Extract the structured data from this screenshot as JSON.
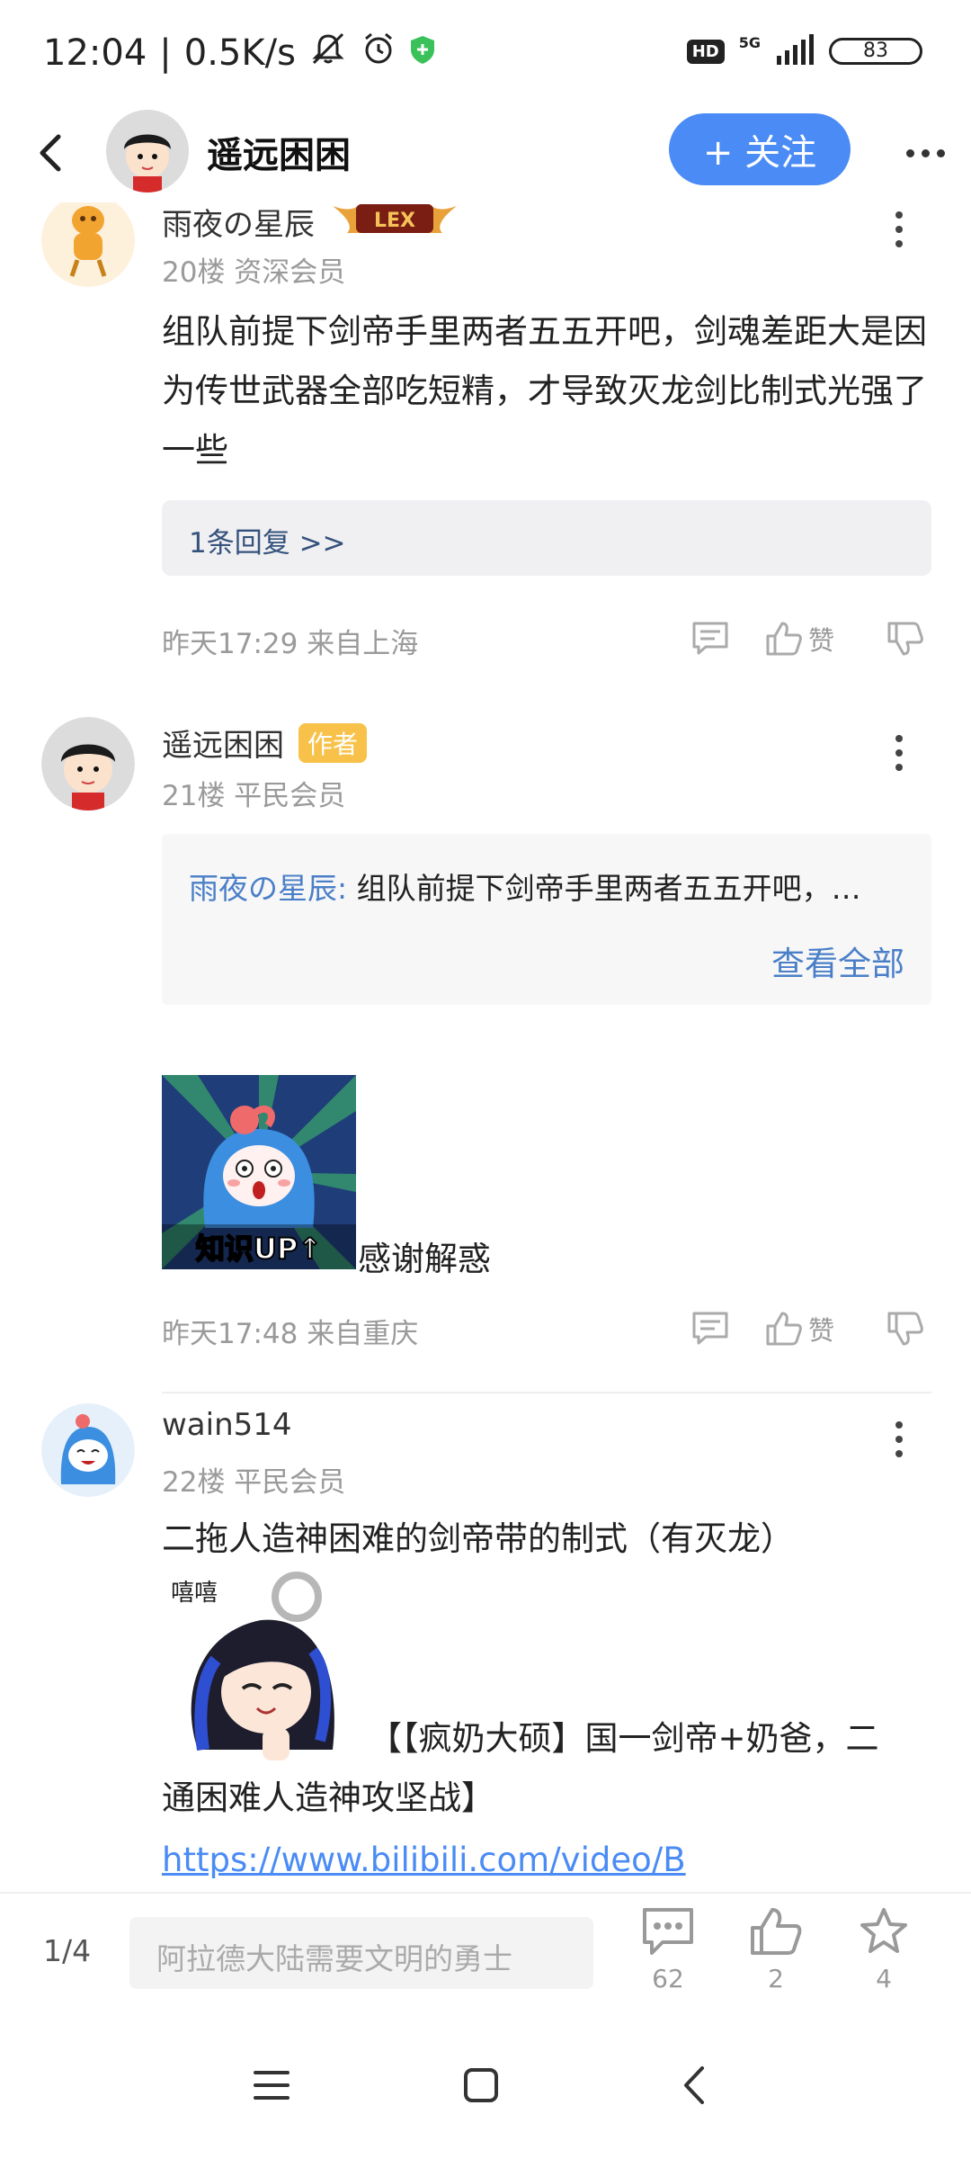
{
  "status_bar": {
    "time": "12:04",
    "speed": "0.5K/s",
    "hd_label": "HD",
    "network_label": "5G",
    "battery": "83"
  },
  "header": {
    "username": "遥远困困",
    "follow_label": "+ 关注"
  },
  "comments": [
    {
      "author": "雨夜の星辰",
      "meta": "20楼 资深会员",
      "text": "组队前提下剑帝手里两者五五开吧，剑魂差距大是因为传世武器全部吃短精，才导致灭龙剑比制式光强了一些",
      "replies_label": "1条回复 >>",
      "time": "昨天17:29 来自上海",
      "like_label": "赞"
    },
    {
      "author": "遥远困困",
      "author_tag": "作者",
      "meta": "21楼 平民会员",
      "quote_author": "雨夜の星辰:",
      "quote_text": " 组队前提下剑帝手里两者五五开吧，…",
      "quote_view_all": "查看全部",
      "sticker_text": "知识UP↑",
      "caption": "感谢解惑",
      "time": "昨天17:48 来自重庆",
      "like_label": "赞"
    },
    {
      "author": "wain514",
      "meta": "22楼 平民会员",
      "text_line1": "二拖人造神困难的剑帝带的制式（有灭龙）",
      "sticker_text": "嘻嘻",
      "text_after_sticker": "【【疯奶大硕】国一剑帝+奶爸，二",
      "text_line3": "通困难人造神攻坚战】",
      "link": "https://www.bilibili.com/video/B"
    }
  ],
  "bottom_bar": {
    "page": "1/4",
    "input_placeholder": "阿拉德大陆需要文明的勇士",
    "comments_count": "62",
    "likes_count": "2",
    "stars_count": "4"
  },
  "colors": {
    "accent": "#4a8bf5",
    "link": "#4a7fc8",
    "meta_gray": "#9a9a9a",
    "author_tag": "#f8c24a"
  }
}
